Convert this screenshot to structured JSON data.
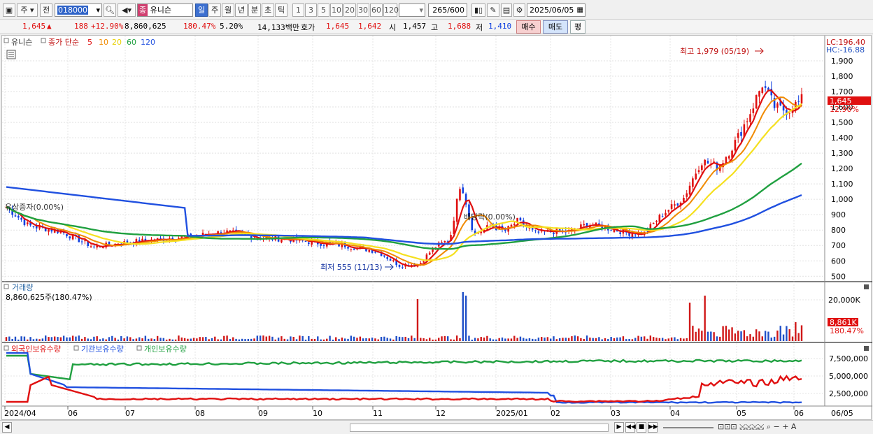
{
  "toolbar": {
    "period_week": "주",
    "period_prev": "전",
    "stock_code": "018000",
    "stock_type_badge": "종",
    "stock_name": "유니슨",
    "tf_buttons": [
      "일",
      "주",
      "월",
      "년",
      "분",
      "초",
      "틱"
    ],
    "n_buttons": [
      "1",
      "3",
      "5",
      "10",
      "20",
      "30",
      "60",
      "120"
    ],
    "count": "265",
    "count_max": "/600",
    "date": "2025/06/05"
  },
  "info": {
    "price": "1,645",
    "arrow": "▲",
    "change": "188",
    "change_pct": "+12.90%",
    "volume": "8,860,625",
    "volume_ratio": "180.47%",
    "turnover": "5.20%",
    "amount": "14,133백만",
    "ask_label": "호가",
    "ask": "1,645",
    "bid": "1,642",
    "open_label": "시",
    "open": "1,457",
    "high_label": "고",
    "high": "1,688",
    "low_label": "저",
    "low": "1,410",
    "buy_btn": "매수",
    "sell_btn": "매도",
    "eval_btn": "평"
  },
  "legend": {
    "name": "유니슨",
    "ma_label": "종가 단순",
    "ma_periods": [
      "5",
      "10",
      "20",
      "60",
      "120"
    ],
    "ma_colors": [
      "#e01010",
      "#f08a00",
      "#f0e000",
      "#20a040",
      "#2050e0"
    ]
  },
  "annotations": {
    "high_label": "최고 1,979 (05/19)",
    "low_label": "최저 555 (11/13)",
    "event1": "유상증자(0.00%)",
    "event2": "배당락(0.00%)"
  },
  "right_axis": {
    "lc": "LC:196.40",
    "hc": "HC:-16.88",
    "price_tag": "1,645",
    "pct_tag": "12.90%",
    "ticks": [
      "1,900",
      "1,800",
      "1,700",
      "1,600",
      "1,500",
      "1,400",
      "1,300",
      "1,200",
      "1,100",
      "1,000",
      "900",
      "800",
      "700",
      "600",
      "500"
    ]
  },
  "volume_pane": {
    "title": "거래량",
    "value": "8,860,625주(180.47%)",
    "tick": "20,000K",
    "tag": "8,861K",
    "tag_pct": "180.47%"
  },
  "holders_pane": {
    "titles": [
      "외국인보유수량",
      "기관보유수량",
      "개인보유수량"
    ],
    "colors": [
      "#e01010",
      "#2050e0",
      "#20a040"
    ],
    "ticks": [
      "7,500,000",
      "5,000,000",
      "2,500,000"
    ]
  },
  "xaxis": [
    "2024/04",
    "06",
    "07",
    "08",
    "09",
    "10",
    "11",
    "12",
    "2025/01",
    "02",
    "03",
    "04",
    "05",
    "06"
  ],
  "xaxis_end": "06/05",
  "colors": {
    "up": "#e01010",
    "down": "#1040e0",
    "accent": "#2d62c8"
  }
}
